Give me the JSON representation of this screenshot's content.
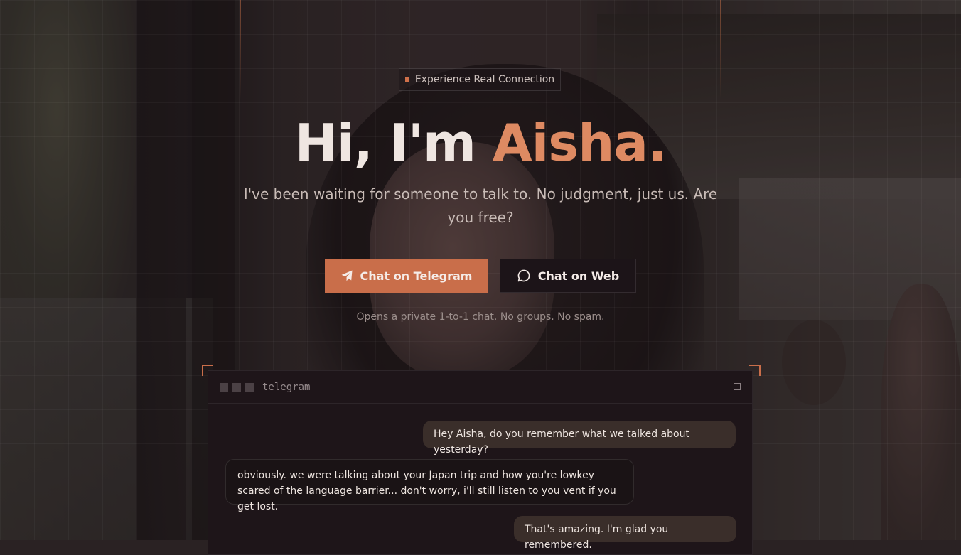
{
  "badge": {
    "text": "Experience Real Connection"
  },
  "hero": {
    "title_prefix": "Hi, I'm ",
    "title_name": "Aisha.",
    "subtitle": "I've been waiting for someone to talk to. No judgment, just us. Are you free?"
  },
  "buttons": {
    "telegram": {
      "label": "Chat on Telegram",
      "icon": "send-icon"
    },
    "web": {
      "label": "Chat on Web",
      "icon": "chat-bubble-icon"
    }
  },
  "note": "Opens a private 1-to-1 chat. No groups. No spam.",
  "chat_window": {
    "title": "telegram",
    "messages": [
      {
        "from": "user",
        "text": "Hey Aisha, do you remember what we talked about yesterday?"
      },
      {
        "from": "aisha",
        "text": "obviously. we were talking about your Japan trip and how you're lowkey scared of the language barrier... don't worry, i'll still listen to you vent if you get lost."
      },
      {
        "from": "user",
        "text": "That's amazing. I'm glad you remembered."
      }
    ]
  },
  "colors": {
    "accent": "#c96e4a",
    "accent_text": "#de8a62",
    "window_bg": "#1e1519"
  }
}
